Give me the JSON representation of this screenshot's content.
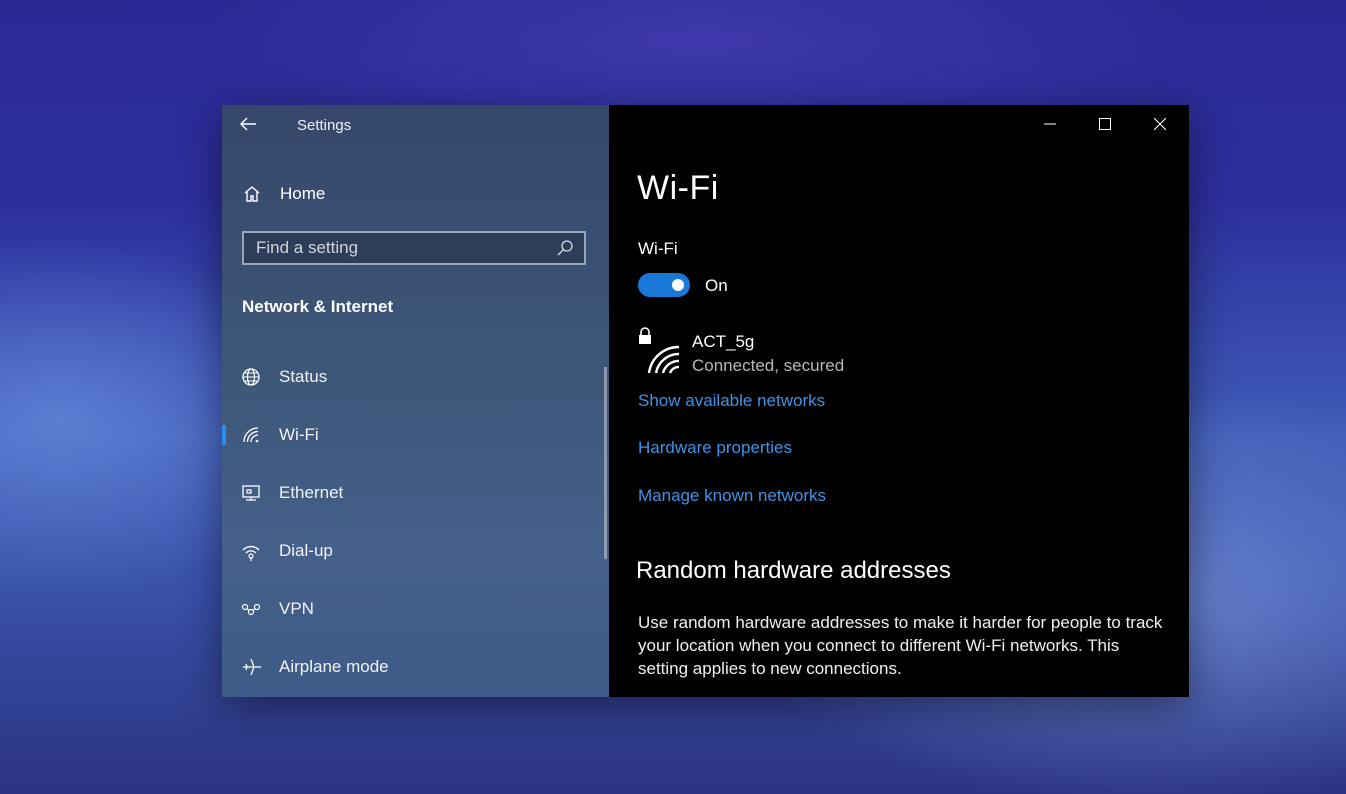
{
  "window": {
    "app_title": "Settings",
    "controls": {
      "minimize": "minimize-icon",
      "maximize": "maximize-icon",
      "close": "close-icon"
    }
  },
  "sidebar": {
    "home_label": "Home",
    "search": {
      "placeholder": "Find a setting"
    },
    "section_title": "Network & Internet",
    "items": [
      {
        "label": "Status",
        "icon": "globe-icon",
        "active": false
      },
      {
        "label": "Wi-Fi",
        "icon": "wifi-icon",
        "active": true
      },
      {
        "label": "Ethernet",
        "icon": "ethernet-icon",
        "active": false
      },
      {
        "label": "Dial-up",
        "icon": "dialup-icon",
        "active": false
      },
      {
        "label": "VPN",
        "icon": "vpn-icon",
        "active": false
      },
      {
        "label": "Airplane mode",
        "icon": "airplane-icon",
        "active": false
      }
    ],
    "accent_color": "#2b8df0"
  },
  "main": {
    "title": "Wi-Fi",
    "wifi_label": "Wi-Fi",
    "toggle_state": "On",
    "toggle_on": true,
    "network": {
      "name": "ACT_5g",
      "status": "Connected, secured"
    },
    "links": {
      "show_networks": "Show available networks",
      "hardware_properties": "Hardware properties",
      "manage_known": "Manage known networks"
    },
    "random_hw": {
      "title": "Random hardware addresses",
      "description": "Use random hardware addresses to make it harder for people to track your location when you connect to different Wi-Fi networks. This setting applies to new connections."
    },
    "link_color": "#3e93e6",
    "toggle_color": "#1a78d8"
  }
}
